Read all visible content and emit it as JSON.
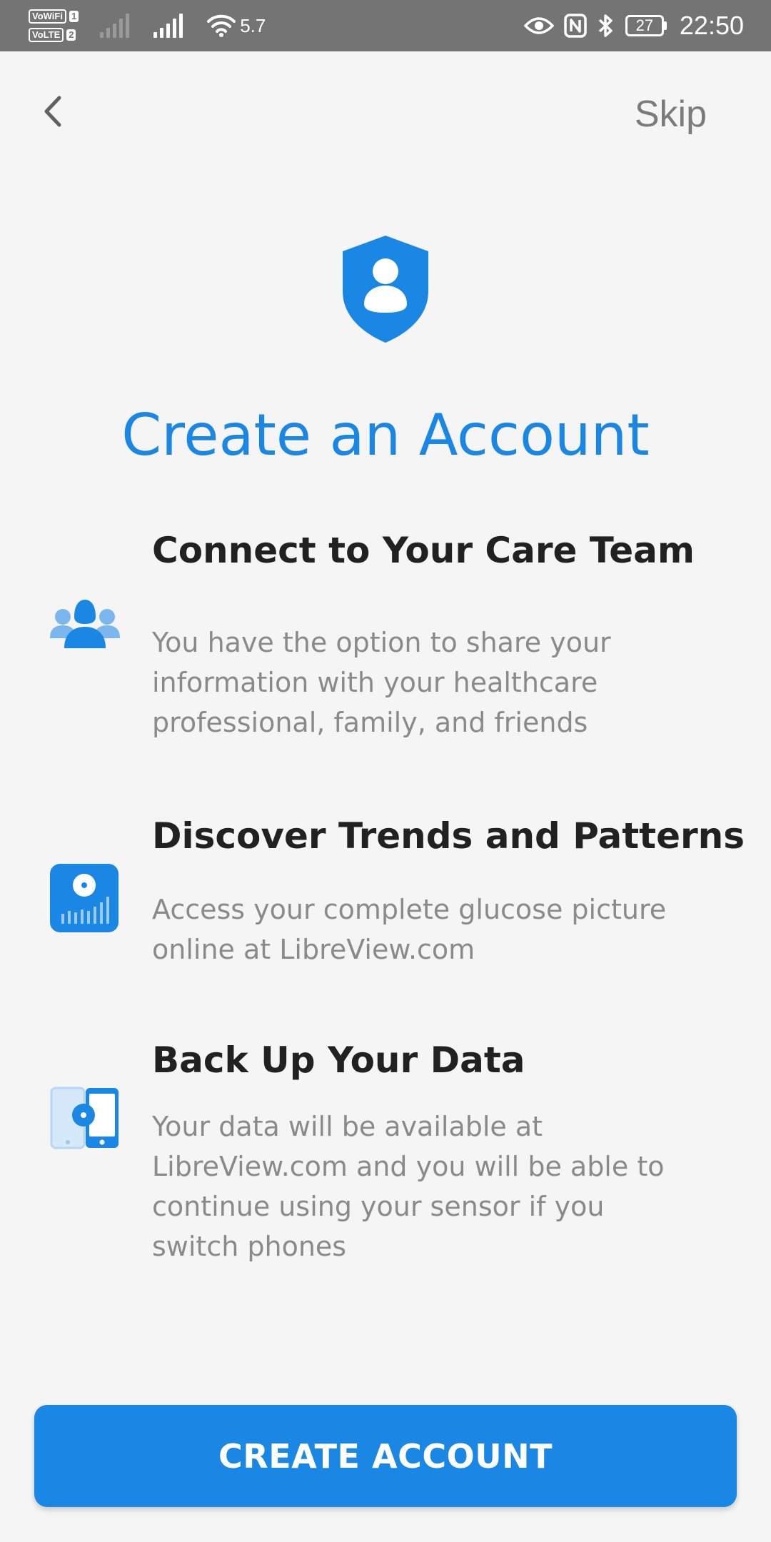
{
  "status_bar": {
    "vowifi_label": "VoWiFi",
    "vowifi_num": "1",
    "volte_label": "VoLTE",
    "volte_num": "2",
    "wifi_speed": "5.7",
    "battery_level": "27",
    "time": "22:50"
  },
  "nav": {
    "back_icon": "chevron-left-icon",
    "skip_label": "Skip"
  },
  "hero": {
    "icon": "shield-user-icon",
    "title": "Create an Account"
  },
  "features": [
    {
      "icon": "care-team-icon",
      "title": "Connect to Your Care Team",
      "description": "You have the option to share your information with your healthcare professional, family, and friends"
    },
    {
      "icon": "trends-icon",
      "title": "Discover Trends and Patterns",
      "description": "Access your complete glucose picture online at LibreView.com"
    },
    {
      "icon": "backup-phones-icon",
      "title": "Back Up Your Data",
      "description": "Your data will be available at LibreView.com and you will be able to continue using your sensor if you switch phones"
    }
  ],
  "cta": {
    "label": "CREATE ACCOUNT"
  },
  "colors": {
    "accent": "#1b87e5",
    "background": "#f5f5f5",
    "status_bar": "#747474",
    "title_text": "#212121",
    "body_text": "#8a8a8a"
  }
}
